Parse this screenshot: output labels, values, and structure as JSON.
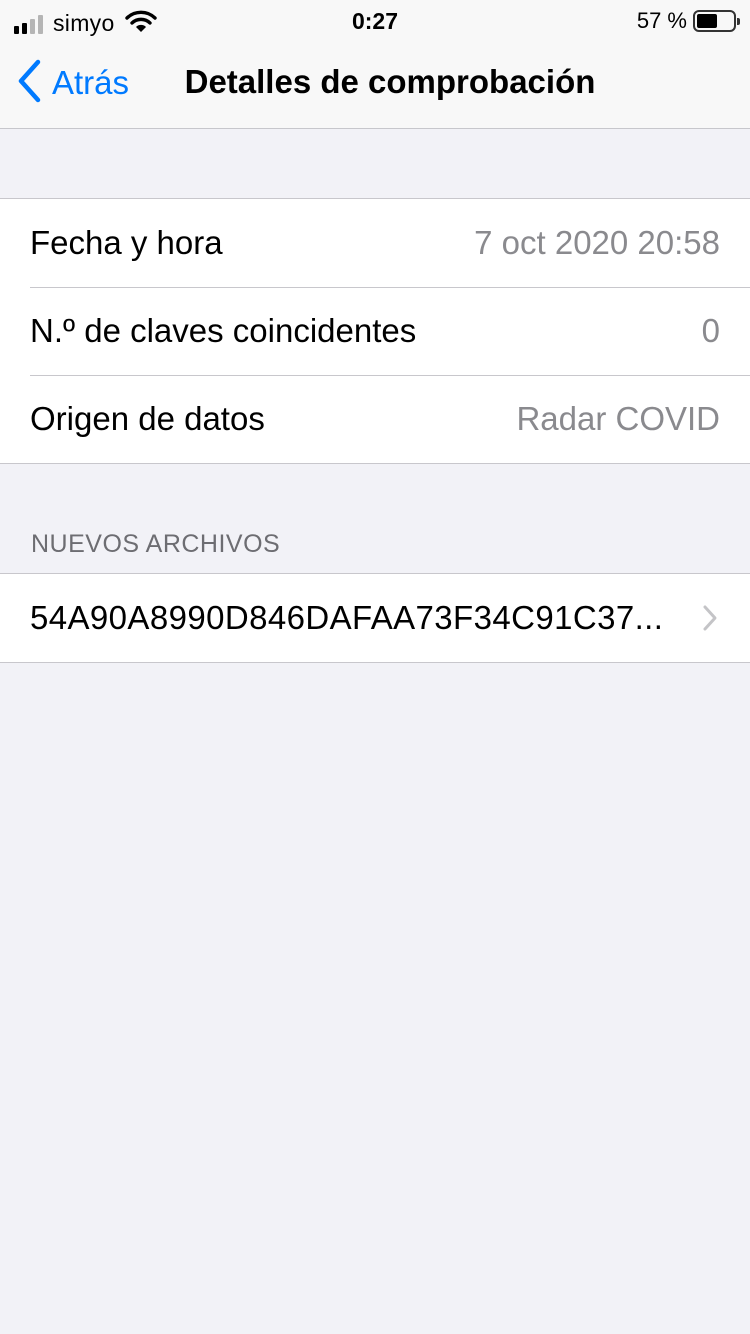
{
  "status_bar": {
    "carrier": "simyo",
    "time": "0:27",
    "battery_percent": "57 %",
    "battery_level": 0.57,
    "signal_bars": 2,
    "signal_total": 4
  },
  "nav": {
    "back_label": "Atrás",
    "title": "Detalles de comprobación",
    "accent_color": "#007aff"
  },
  "details": [
    {
      "label": "Fecha y hora",
      "value": "7 oct 2020 20:58"
    },
    {
      "label": "N.º de claves coincidentes",
      "value": "0"
    },
    {
      "label": "Origen de datos",
      "value": "Radar COVID"
    }
  ],
  "files_section": {
    "header": "NUEVOS ARCHIVOS",
    "items": [
      {
        "label": "54A90A8990D846DAFAA73F34C91C37..."
      }
    ]
  },
  "icons": {
    "back": "chevron-left-icon",
    "disclosure": "chevron-right-icon",
    "wifi": "wifi-icon",
    "signal": "cellular-signal-icon",
    "battery": "battery-icon"
  }
}
